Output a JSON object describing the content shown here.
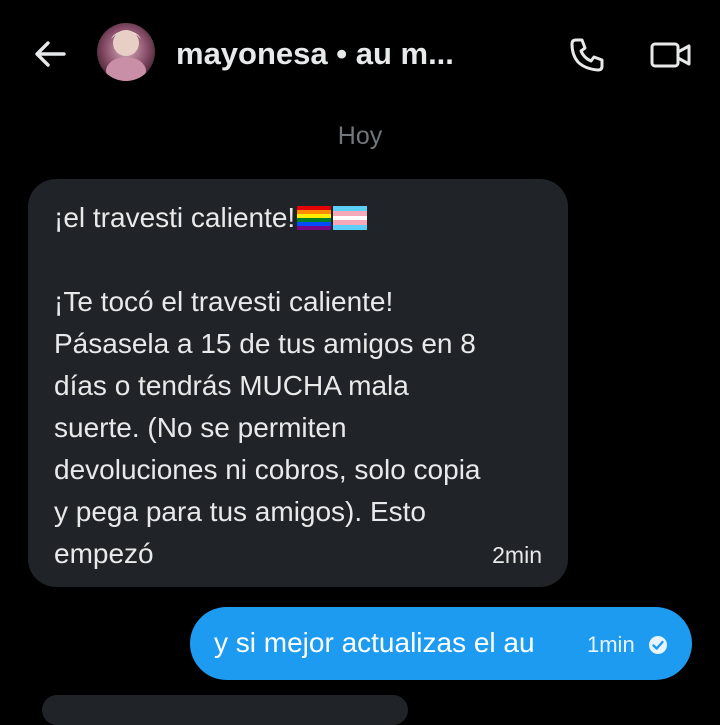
{
  "header": {
    "title": "mayonesa • au m...",
    "back_icon": "arrow-left-icon",
    "call_icon": "phone-icon",
    "video_icon": "video-camera-icon"
  },
  "conversation": {
    "date_separator": "Hoy",
    "incoming": {
      "lines": [
        "¡el travesti caliente!",
        "",
        "¡Te tocó el travesti caliente!",
        "Pásasela a 15 de tus amigos en 8",
        "días o tendrás MUCHA mala",
        "suerte. (No se permiten",
        "devoluciones ni cobros, solo copia",
        "y pega para tus amigos). Esto",
        "empezó"
      ],
      "emojis": [
        "rainbow-flag",
        "transgender-flag"
      ],
      "time": "2min"
    },
    "outgoing": {
      "text": "y si mejor actualizas el au",
      "time": "1min",
      "status_icon": "read-check-icon"
    }
  },
  "colors": {
    "background": "#000000",
    "incoming_bubble": "#202327",
    "outgoing_bubble": "#1d9bf0",
    "muted_text": "#71767b"
  }
}
